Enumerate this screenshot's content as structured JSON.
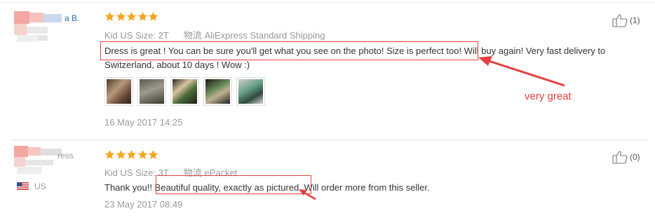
{
  "reviews": [
    {
      "name": "a B.",
      "country": "",
      "stars": 5,
      "size_label": "Kid US Size:",
      "size_value": "2T",
      "ship_label": "物流",
      "ship_value": "AliExpress Standard Shipping",
      "text_line1": "Dress is great ! You can be sure you'll get what you see on the photo! Size is perfect too! Will buy again! Very fast delivery to",
      "text_line2": "Switzerland, about 10 days ! Wow :)",
      "date": "16 May 2017 14:25",
      "likes": "(1)",
      "photos": [
        "photo-1",
        "photo-2",
        "photo-3",
        "photo-4",
        "photo-5"
      ]
    },
    {
      "name": "ress",
      "country": "US",
      "stars": 5,
      "size_label": "Kid US Size:",
      "size_value": "3T",
      "ship_label": "物流",
      "ship_value": "ePacket",
      "text": "Thank you!! Beautiful quality, exactly as pictured. Will order more from this seller.",
      "date": "23 May 2017 08:49",
      "likes": "(0)"
    }
  ],
  "annotation": {
    "label": "very great",
    "color": "#e34040"
  },
  "colors": {
    "star": "#f5a623",
    "name_link": "#2a6fb6",
    "muted": "#999999"
  }
}
